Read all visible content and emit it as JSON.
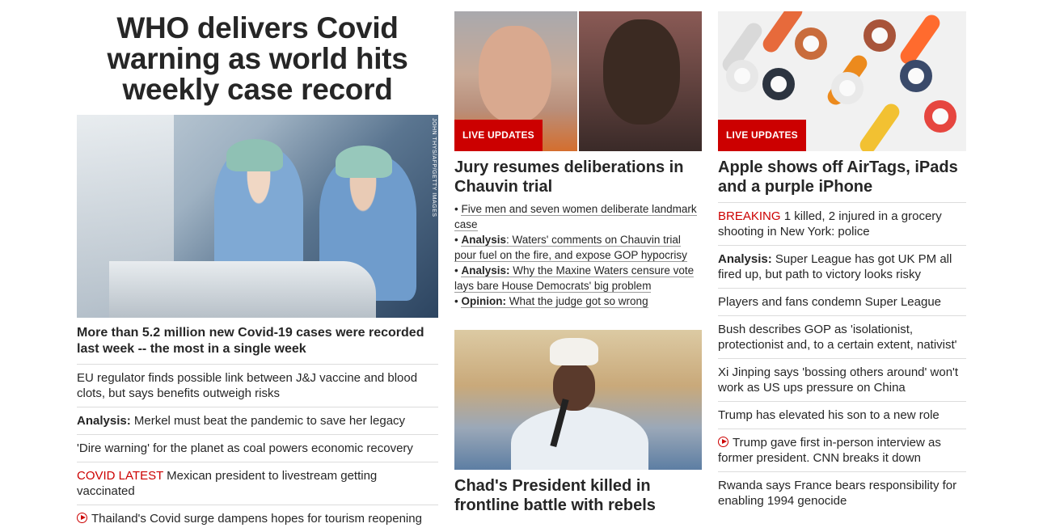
{
  "column1": {
    "headline": "WHO delivers Covid warning as world hits weekly case record",
    "image_credit": "JOHN THYS/AFP/GETTY IMAGES",
    "lead": "More than 5.2 million new Covid-19 cases were recorded last week -- the most in a single week",
    "items": [
      {
        "prefix": "",
        "text": "EU regulator finds possible link between J&J vaccine and blood clots, but says benefits outweigh risks"
      },
      {
        "prefix": "Analysis:",
        "text": " Merkel must beat the pandemic to save her legacy"
      },
      {
        "prefix": "",
        "text": "'Dire warning' for the planet as coal powers economic recovery"
      },
      {
        "tag": "COVID LATEST",
        "text": " Mexican president to livestream getting vaccinated"
      },
      {
        "video": true,
        "text": "Thailand's Covid surge dampens hopes for tourism reopening"
      }
    ]
  },
  "column2": {
    "card1": {
      "badge": "LIVE UPDATES",
      "title": "Jury resumes deliberations in Chauvin trial",
      "bullets": [
        {
          "label": "",
          "text": "Five men and seven women deliberate landmark case"
        },
        {
          "label": "Analysis",
          "text": ": Waters' comments on Chauvin trial pour fuel on the fire, and expose GOP hypocrisy"
        },
        {
          "label": "Analysis:",
          "text": " Why the Maxine Waters censure vote lays bare House Democrats' big problem"
        },
        {
          "label": "Opinion:",
          "text": " What the judge got so wrong"
        }
      ]
    },
    "card2": {
      "title": "Chad's President killed in frontline battle with rebels"
    }
  },
  "column3": {
    "badge": "LIVE UPDATES",
    "title": "Apple shows off AirTags, iPads and a purple iPhone",
    "items": [
      {
        "tag": "BREAKING",
        "text": " 1 killed, 2 injured in a grocery shooting in New York: police"
      },
      {
        "prefix": "Analysis:",
        "text": " Super League has got UK PM all fired up, but path to victory looks risky"
      },
      {
        "text": "Players and fans condemn Super League"
      },
      {
        "text": "Bush describes GOP as 'isolationist, protectionist and, to a certain extent, nativist'"
      },
      {
        "text": "Xi Jinping says 'bossing others around' won't work as US ups pressure on China"
      },
      {
        "text": "Trump has elevated his son to a new role"
      },
      {
        "video": true,
        "text": "Trump gave first in-person interview as former president. CNN breaks it down"
      },
      {
        "text": "Rwanda says France bears responsibility for enabling 1994 genocide"
      }
    ]
  },
  "colors": {
    "accent_red": "#cc0000",
    "text": "#262626",
    "divider": "#dcdcdc"
  }
}
